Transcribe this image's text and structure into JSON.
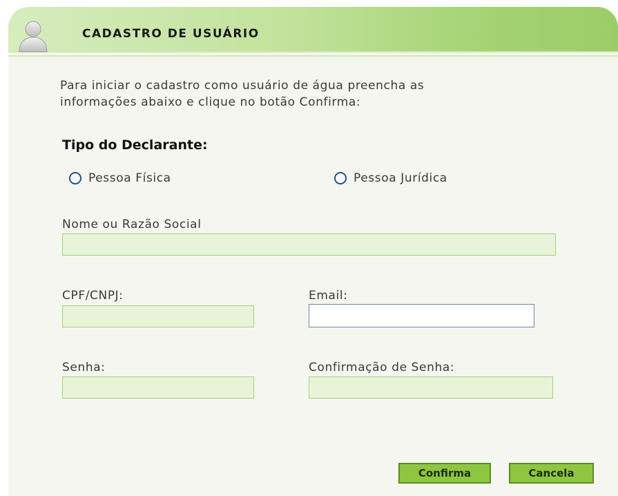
{
  "header": {
    "title": "CADASTRO DE USUÁRIO",
    "avatar_icon": "user-avatar-icon"
  },
  "intro": {
    "line1": "Para iniciar o cadastro como usuário de água preencha as",
    "line2": "informações abaixo e clique no botão Confirma:"
  },
  "declarant": {
    "heading": "Tipo do Declarante:",
    "options": [
      {
        "label": "Pessoa Física",
        "selected": false
      },
      {
        "label": "Pessoa Jurídica",
        "selected": false
      }
    ]
  },
  "form": {
    "nome_label": "Nome ou Razão Social",
    "nome_value": "",
    "cpf_label": "CPF/CNPJ:",
    "cpf_value": "",
    "email_label": "Email:",
    "email_value": "",
    "senha_label": "Senha:",
    "senha_value": "",
    "confirm_senha_label": "Confirmação de Senha:",
    "confirm_senha_value": ""
  },
  "actions": {
    "confirm_label": "Confirma",
    "cancel_label": "Cancela"
  },
  "colors": {
    "header_green": "#9acd67",
    "panel_bg": "#f4f6ef",
    "field_bg": "#e8f3d9",
    "field_border": "#a3d27c",
    "button_bg": "#8ec641",
    "radio_blue": "#1f4f8b"
  }
}
